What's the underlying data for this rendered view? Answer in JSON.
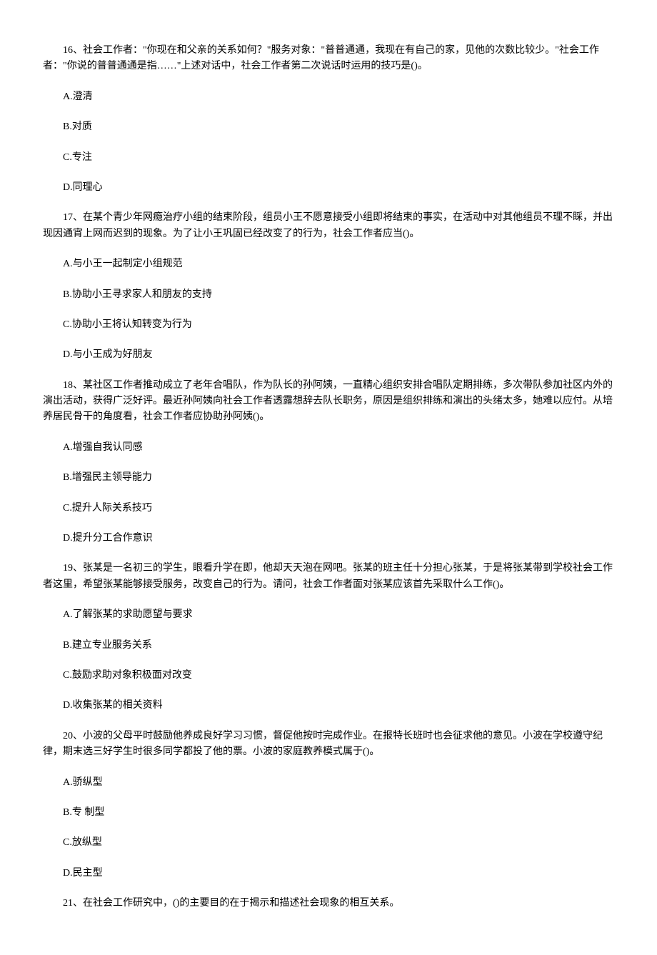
{
  "questions": [
    {
      "number": "16、",
      "text": "社会工作者：\"你现在和父亲的关系如何？\"服务对象：\"普普通通，我现在有自己的家，见他的次数比较少。\"社会工作者：\"你说的普普通通是指……\"上述对话中，社会工作者第二次说话时运用的技巧是()。",
      "options": [
        "A.澄清",
        "B.对质",
        "C.专注",
        "D.同理心"
      ]
    },
    {
      "number": "17、",
      "text": "在某个青少年网瘾治疗小组的结束阶段，组员小王不愿意接受小组即将结束的事实，在活动中对其他组员不理不睬，并出现因通宵上网而迟到的现象。为了让小王巩固已经改变了的行为，社会工作者应当()。",
      "options": [
        "A.与小王一起制定小组规范",
        "B.协助小王寻求家人和朋友的支持",
        "C.协助小王将认知转变为行为",
        "D.与小王成为好朋友"
      ]
    },
    {
      "number": "18、",
      "text": "某社区工作者推动成立了老年合唱队，作为队长的孙阿姨，一直精心组织安排合唱队定期排练，多次带队参加社区内外的演出活动，获得广泛好评。最近孙阿姨向社会工作者透露想辞去队长职务，原因是组织排练和演出的头绪太多，她难以应付。从培养居民骨干的角度看，社会工作者应协助孙阿姨()。",
      "options": [
        "A.增强自我认同感",
        "B.增强民主领导能力",
        "C.提升人际关系技巧",
        "D.提升分工合作意识"
      ]
    },
    {
      "number": "19、",
      "text": "张某是一名初三的学生，眼看升学在即，他却天天泡在网吧。张某的班主任十分担心张某，于是将张某带到学校社会工作者这里，希望张某能够接受服务，改变自己的行为。请问，社会工作者面对张某应该首先采取什么工作()。",
      "options": [
        "A.了解张某的求助愿望与要求",
        "B.建立专业服务关系",
        "C.鼓励求助对象积极面对改变",
        "D.收集张某的相关资料"
      ]
    },
    {
      "number": "20、",
      "text": "小波的父母平时鼓励他养成良好学习习惯，督促他按时完成作业。在报特长班时也会征求他的意见。小波在学校遵守纪律，期末选三好学生时很多同学都投了他的票。小波的家庭教养模式属于()。",
      "options": [
        "A.骄纵型",
        "B.专 制型",
        "C.放纵型",
        "D.民主型"
      ]
    },
    {
      "number": "21、",
      "text": "在社会工作研究中，()的主要目的在于揭示和描述社会现象的相互关系。",
      "options": []
    }
  ]
}
